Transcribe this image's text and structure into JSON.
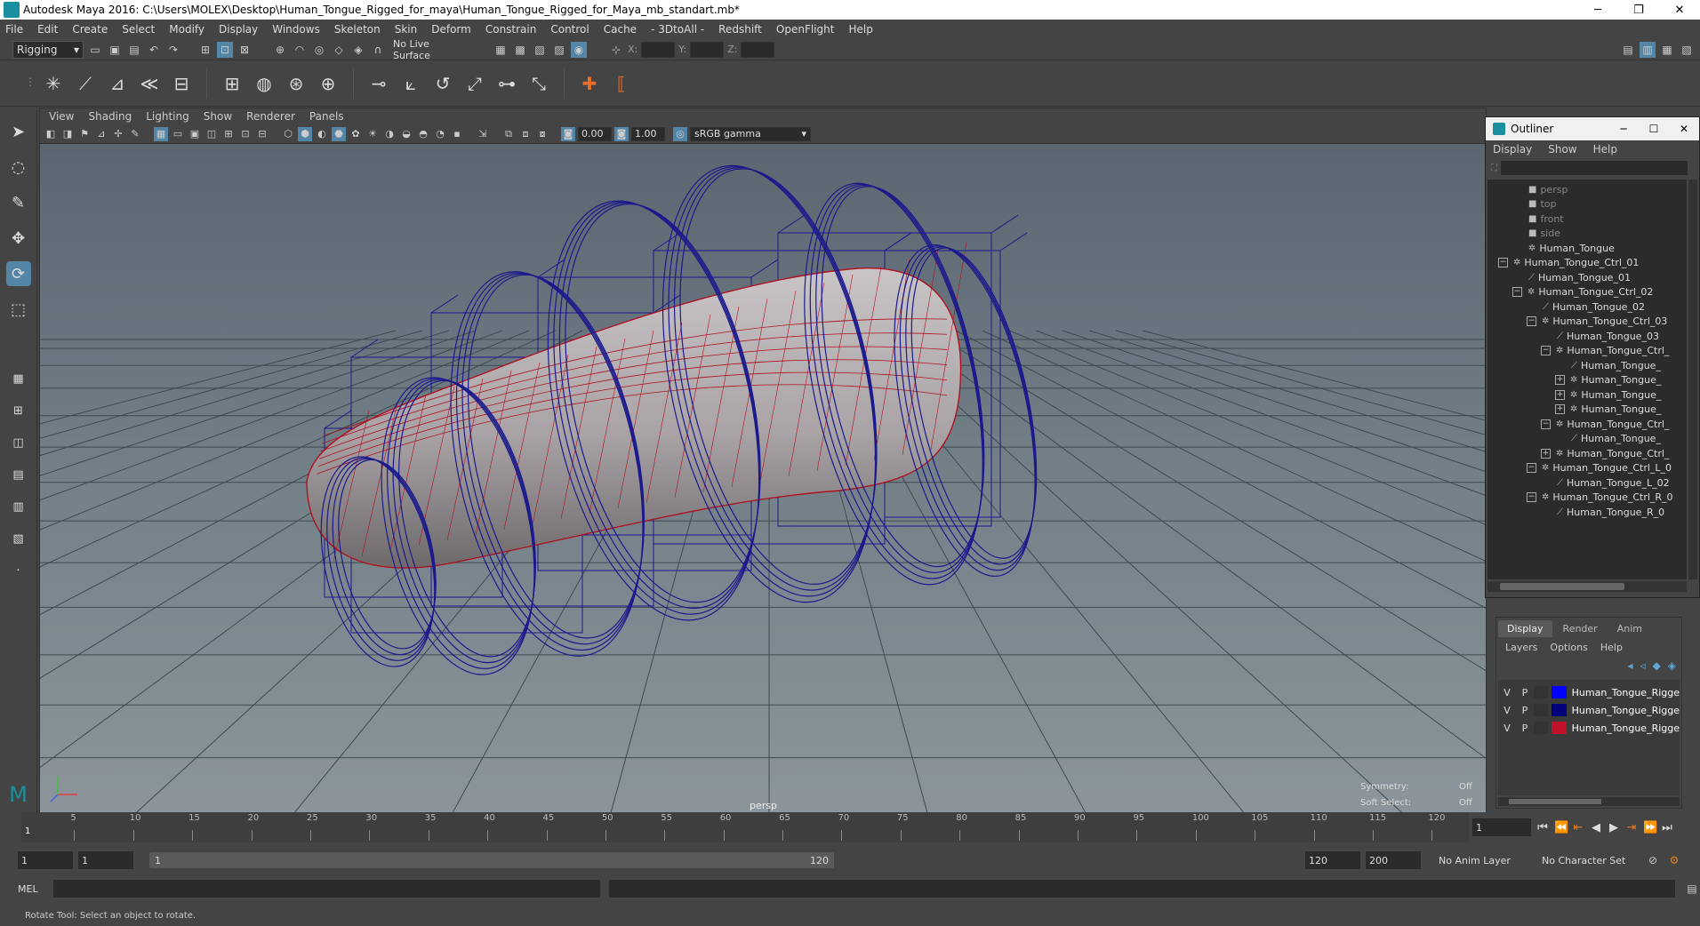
{
  "window": {
    "title": "Autodesk Maya 2016: C:\\Users\\MOLEX\\Desktop\\Human_Tongue_Rigged_for_maya\\Human_Tongue_Rigged_for_Maya_mb_standart.mb*",
    "minimize": "─",
    "restore": "❐",
    "close": "✕"
  },
  "menubar": [
    "File",
    "Edit",
    "Create",
    "Select",
    "Modify",
    "Display",
    "Windows",
    "Skeleton",
    "Skin",
    "Deform",
    "Constrain",
    "Control",
    "Cache",
    "- 3DtoAll -",
    "Redshift",
    "OpenFlight",
    "Help"
  ],
  "statusline": {
    "menuset": "Rigging",
    "live_surface": "No Live Surface",
    "x_label": "X:",
    "y_label": "Y:",
    "z_label": "Z:"
  },
  "panel": {
    "menus": [
      "View",
      "Shading",
      "Lighting",
      "Show",
      "Renderer",
      "Panels"
    ],
    "near_value": "0.00",
    "far_value": "1.00",
    "color_space": "sRGB gamma",
    "camera_label": "persp",
    "hud": {
      "symmetry_label": "Symmetry:",
      "symmetry_value": "Off",
      "soft_select_label": "Soft Select:",
      "soft_select_value": "Off"
    }
  },
  "outliner": {
    "title": "Outliner",
    "menus": [
      "Display",
      "Show",
      "Help"
    ],
    "items": [
      {
        "label": "persp",
        "type": "camera",
        "dim": true
      },
      {
        "label": "top",
        "type": "camera",
        "dim": true
      },
      {
        "label": "front",
        "type": "camera",
        "dim": true
      },
      {
        "label": "side",
        "type": "camera",
        "dim": true
      },
      {
        "label": "Human_Tongue",
        "type": "mesh"
      },
      {
        "label": "Human_Tongue_Ctrl_01",
        "type": "ctrl",
        "expander": "−"
      },
      {
        "label": "Human_Tongue_01",
        "type": "joint"
      },
      {
        "label": "Human_Tongue_Ctrl_02",
        "type": "ctrl",
        "expander": "−"
      },
      {
        "label": "Human_Tongue_02",
        "type": "joint"
      },
      {
        "label": "Human_Tongue_Ctrl_03",
        "type": "ctrl",
        "expander": "−"
      },
      {
        "label": "Human_Tongue_03",
        "type": "joint"
      },
      {
        "label": "Human_Tongue_Ctrl_",
        "type": "ctrl",
        "expander": "−"
      },
      {
        "label": "Human_Tongue_",
        "type": "joint"
      },
      {
        "label": "Human_Tongue_",
        "type": "ctrl",
        "expander": "+"
      },
      {
        "label": "Human_Tongue_",
        "type": "ctrl",
        "expander": "+"
      },
      {
        "label": "Human_Tongue_",
        "type": "ctrl",
        "expander": "+"
      },
      {
        "label": "Human_Tongue_Ctrl_",
        "type": "ctrl",
        "expander": "−"
      },
      {
        "label": "Human_Tongue_",
        "type": "joint"
      },
      {
        "label": "Human_Tongue_Ctrl_",
        "type": "ctrl",
        "expander": "+"
      },
      {
        "label": "Human_Tongue_Ctrl_L_0",
        "type": "ctrl",
        "expander": "−"
      },
      {
        "label": "Human_Tongue_L_02",
        "type": "joint"
      },
      {
        "label": "Human_Tongue_Ctrl_R_0",
        "type": "ctrl",
        "expander": "−"
      },
      {
        "label": "Human_Tongue_R_0",
        "type": "joint"
      }
    ]
  },
  "layers": {
    "tabs": [
      "Display",
      "Render",
      "Anim"
    ],
    "menus": [
      "Layers",
      "Options",
      "Help"
    ],
    "rows": [
      {
        "v": "V",
        "p": "P",
        "color": "#0000ff",
        "name": "Human_Tongue_Rigge"
      },
      {
        "v": "V",
        "p": "P",
        "color": "#00007a",
        "name": "Human_Tongue_Rigge"
      },
      {
        "v": "V",
        "p": "P",
        "color": "#c0102a",
        "name": "Human_Tongue_Rigge"
      }
    ]
  },
  "timeline": {
    "ticks": [
      "5",
      "10",
      "15",
      "20",
      "25",
      "30",
      "35",
      "40",
      "45",
      "50",
      "55",
      "60",
      "65",
      "70",
      "75",
      "80",
      "85",
      "90",
      "95",
      "100",
      "105",
      "110",
      "115",
      "120"
    ],
    "current_frame_marker": "1",
    "current_frame": "1"
  },
  "range": {
    "start": "1",
    "anim_start": "1",
    "bar_start": "1",
    "bar_end": "120",
    "end": "120",
    "anim_end": "200",
    "anim_layer": "No Anim Layer",
    "character_set": "No Character Set"
  },
  "cmdline": {
    "lang": "MEL"
  },
  "helpline": {
    "text": "Rotate Tool: Select an object to rotate."
  },
  "colors": {
    "accent": "#5285a6",
    "wire_blue": "#1a1a8c",
    "wire_red": "#b01020"
  }
}
